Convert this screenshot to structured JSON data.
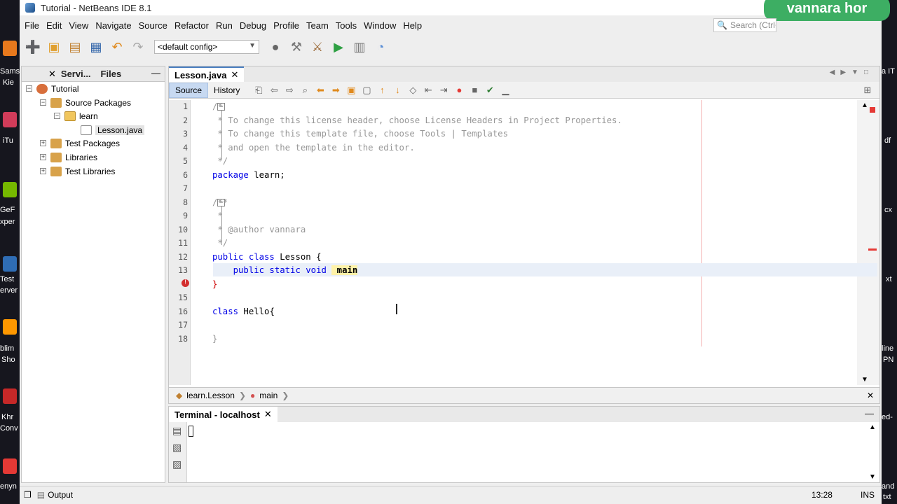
{
  "window": {
    "title": "Tutorial - NetBeans IDE 8.1"
  },
  "watermark": "vannara hor",
  "menu": [
    "File",
    "Edit",
    "View",
    "Navigate",
    "Source",
    "Refactor",
    "Run",
    "Debug",
    "Profile",
    "Team",
    "Tools",
    "Window",
    "Help"
  ],
  "search": {
    "placeholder": "Search (Ctrl+I)"
  },
  "toolbar": {
    "config": "<default config>"
  },
  "projects": {
    "tabs": [
      "Servi...",
      "Files"
    ],
    "tree": [
      {
        "label": "Tutorial",
        "icon": "project-icon"
      },
      {
        "label": "Source Packages",
        "icon": "source-packages-icon"
      },
      {
        "label": "learn",
        "icon": "package-icon"
      },
      {
        "label": "Lesson.java",
        "icon": "java-file-icon"
      },
      {
        "label": "Test Packages",
        "icon": "test-packages-icon"
      },
      {
        "label": "Libraries",
        "icon": "libraries-icon"
      },
      {
        "label": "Test Libraries",
        "icon": "test-libraries-icon"
      }
    ]
  },
  "editor": {
    "tab": "Lesson.java",
    "views": [
      "Source",
      "History"
    ],
    "lines": [
      {
        "n": "1",
        "text": "/*"
      },
      {
        "n": "2",
        "text": " * To change this license header, choose License Headers in Project Properties."
      },
      {
        "n": "3",
        "text": " * To change this template file, choose Tools | Templates"
      },
      {
        "n": "4",
        "text": " * and open the template in the editor."
      },
      {
        "n": "5",
        "text": " */"
      },
      {
        "n": "6",
        "kw": "package",
        "text": " learn;"
      },
      {
        "n": "7",
        "text": ""
      },
      {
        "n": "8",
        "text": "/**"
      },
      {
        "n": "9",
        "text": " *"
      },
      {
        "n": "10",
        "text": " * @author vannara"
      },
      {
        "n": "11",
        "text": " */"
      },
      {
        "n": "12",
        "kw": "public class",
        "text": " Lesson {"
      },
      {
        "n": "13",
        "kw": "    public static void",
        "text": " main"
      },
      {
        "n": "",
        "text": "}"
      },
      {
        "n": "15",
        "text": ""
      },
      {
        "n": "16",
        "kw": "class",
        "text": " Hello{"
      },
      {
        "n": "17",
        "text": ""
      },
      {
        "n": "18",
        "text": "}"
      }
    ]
  },
  "breadcrumb": [
    "learn.Lesson",
    "main"
  ],
  "terminal": {
    "tab": "Terminal - localhost"
  },
  "status": {
    "output": "Output",
    "position": "13:28",
    "mode": "INS"
  },
  "desktop": {
    "left_labels": [
      "Sams",
      "Kie",
      "iTu",
      "GeF",
      "xper",
      "Test",
      "erver",
      "blim",
      "Sho",
      "Khr",
      "Conv",
      "enyn"
    ],
    "right_labels": [
      "a IT",
      "df",
      "cx",
      "xt",
      "line",
      "PN",
      "ed-",
      "and",
      "txt"
    ]
  }
}
